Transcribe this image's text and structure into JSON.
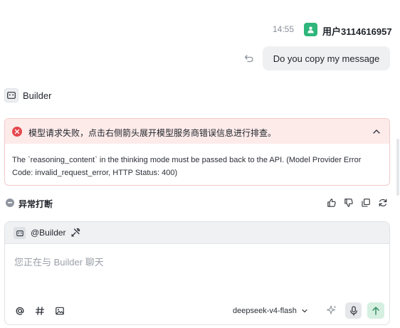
{
  "user_message": {
    "time": "14:55",
    "username": "用户3114616957",
    "text": "Do you copy my message",
    "avatar_color": "#2fb67c"
  },
  "bot": {
    "name": "Builder"
  },
  "error": {
    "title": "模型请求失败，点击右侧箭头展开模型服务商错误信息进行排查。",
    "detail": "The `reasoning_content` in the thinking mode must be passed back to the API. (Model Provider Error Code: invalid_request_error, HTTP Status: 400)",
    "accent": "#e5484d",
    "background": "#fdebea"
  },
  "interrupted": {
    "label": "异常打断"
  },
  "message_actions": [
    "thumbs-up-icon",
    "thumbs-down-icon",
    "copy-icon",
    "refresh-icon"
  ],
  "composer": {
    "mention": "@Builder",
    "placeholder": "您正在与 Builder 聊天",
    "model": "deepseek-v4-flash",
    "toolbar_icons": [
      "at-icon",
      "hash-icon",
      "image-icon"
    ],
    "send_color": "#d5efe1"
  }
}
